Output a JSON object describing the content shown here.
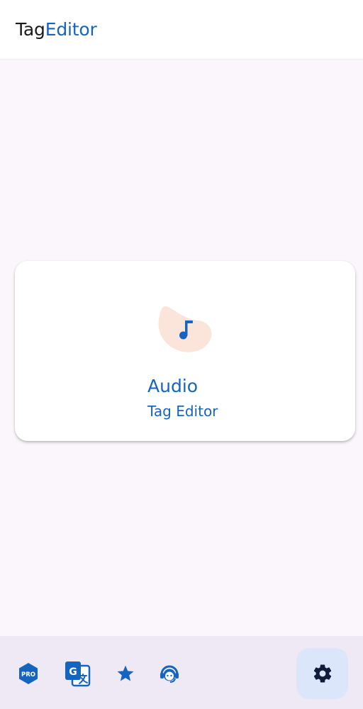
{
  "app": {
    "title_part1": "Tag",
    "title_part2": "Editor"
  },
  "card": {
    "title": "Audio",
    "subtitle": "Tag Editor",
    "icon": "music-note-icon"
  },
  "bottom_nav": {
    "pro_label": "PRO",
    "pro_icon": "pro-badge-icon",
    "translate_icon": "translate-icon",
    "rate_icon": "star-icon",
    "support_icon": "support-agent-icon",
    "settings_icon": "gear-icon"
  },
  "colors": {
    "accent": "#1565c0",
    "background": "#fbf6fb",
    "bottom_bar": "#efe9f6",
    "settings_highlight": "#dce6fb",
    "blob": "#fbe5da"
  }
}
